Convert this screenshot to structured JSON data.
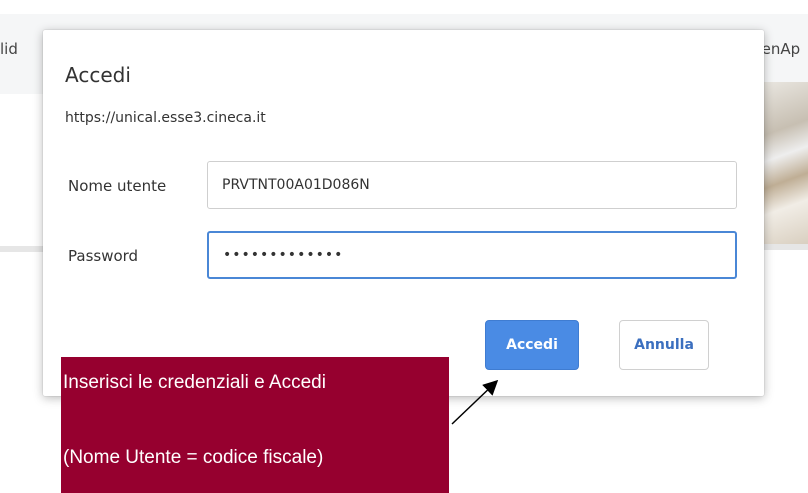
{
  "background": {
    "tab_left_text": "lid",
    "tab_right_text": "XenAp"
  },
  "dialog": {
    "title": "Accedi",
    "url": "https://unical.esse3.cineca.it",
    "username_label": "Nome utente",
    "username_value": "PRVTNT00A01D086N",
    "password_label": "Password",
    "password_value": "•••••••••••••",
    "submit_label": "Accedi",
    "cancel_label": "Annulla",
    "accent_color": "#4a8be4"
  },
  "annotation": {
    "line1": "Inserisci le credenziali e Accedi",
    "line2": "(Nome Utente = codice fiscale)",
    "background_color": "#96002f"
  }
}
